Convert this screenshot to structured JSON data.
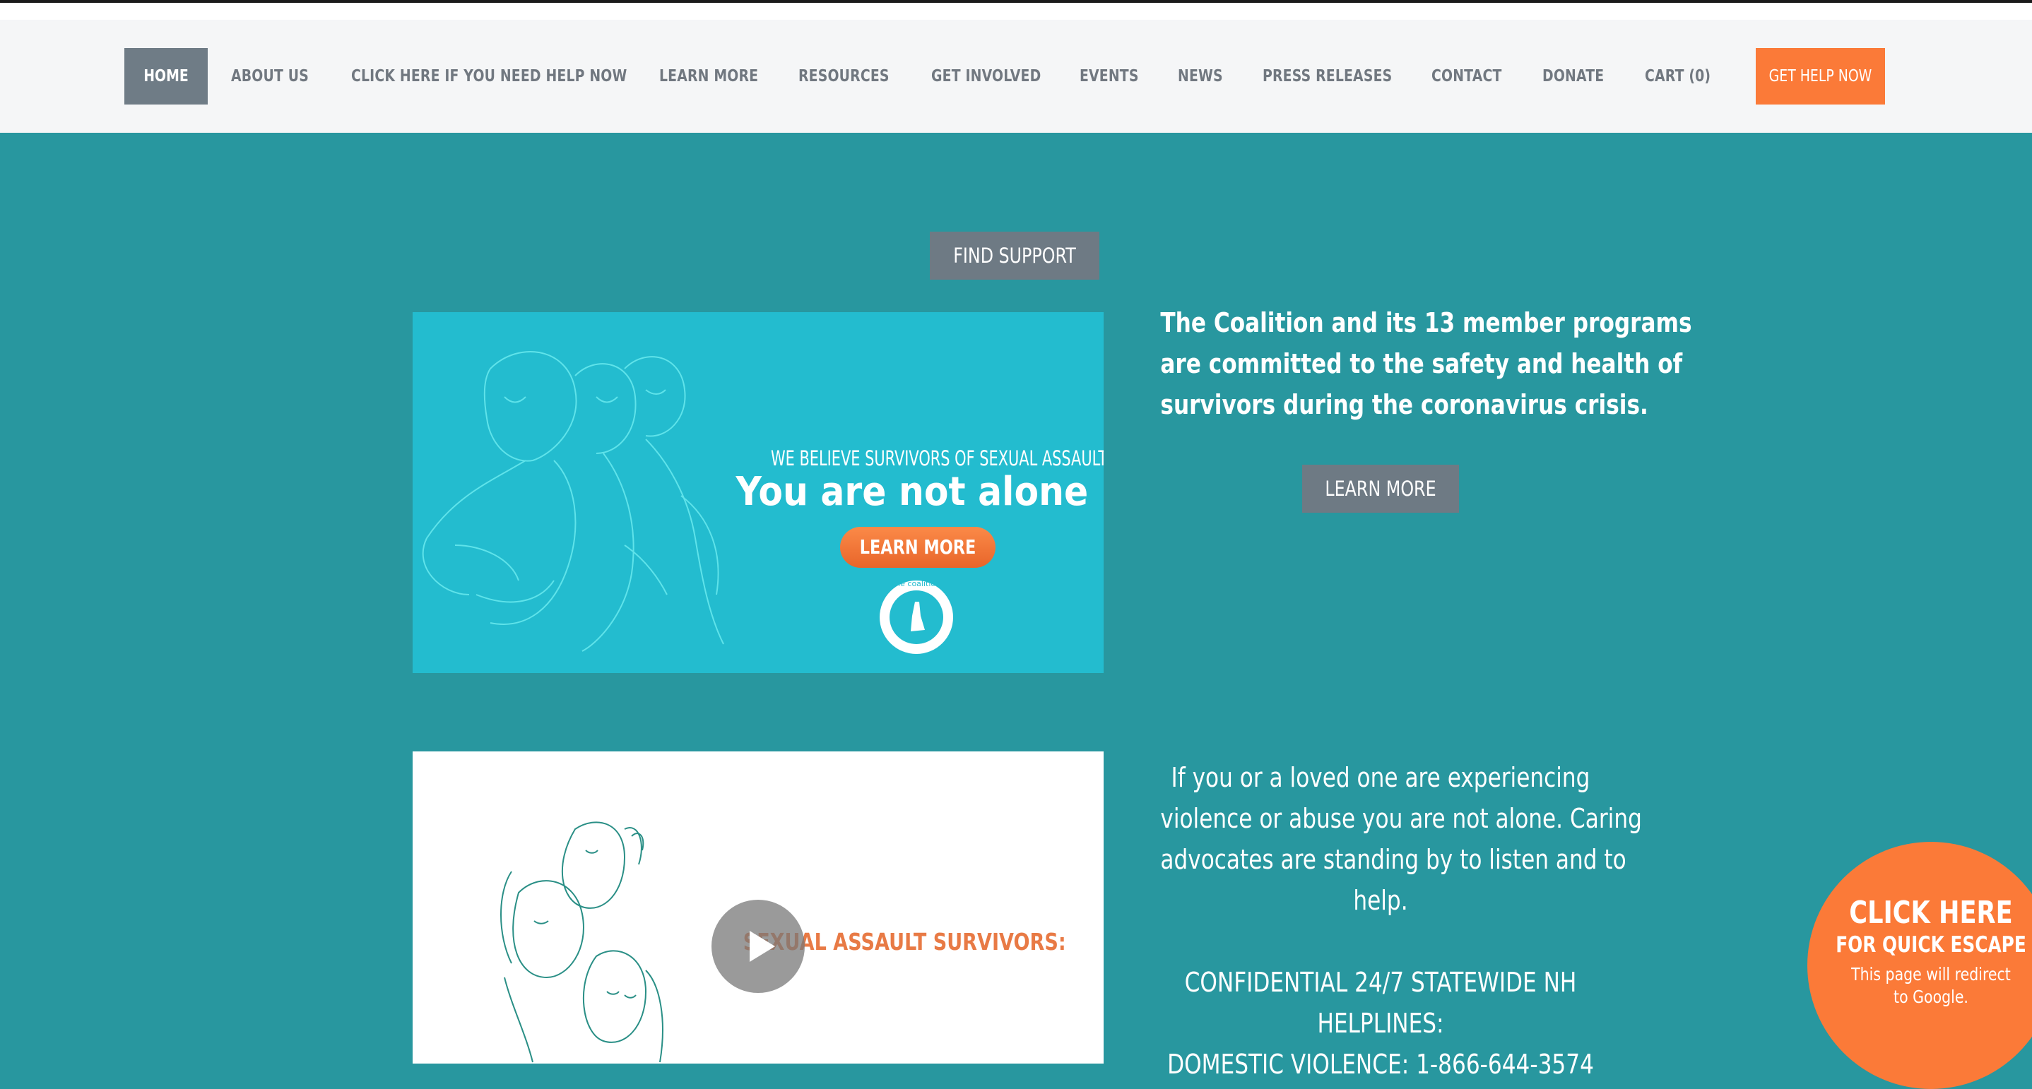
{
  "nav": {
    "items": [
      {
        "label": "HOME"
      },
      {
        "label": "ABOUT US"
      },
      {
        "label": "CLICK HERE IF YOU NEED HELP NOW"
      },
      {
        "label": "LEARN MORE"
      },
      {
        "label": "RESOURCES"
      },
      {
        "label": "GET INVOLVED"
      },
      {
        "label": "EVENTS"
      },
      {
        "label": "NEWS"
      },
      {
        "label": "PRESS RELEASES"
      },
      {
        "label": "CONTACT"
      },
      {
        "label": "DONATE"
      },
      {
        "label": "CART (0)"
      }
    ],
    "cta_label": "GET HELP NOW",
    "active_color": "#6f7c86",
    "cta_color": "#fb7a38"
  },
  "hero": {
    "find_support_label": "FIND SUPPORT",
    "coalition_text": [
      "The Coalition and its 13 member programs",
      "are committed to the safety and health of",
      "survivors during the coronavirus crisis."
    ],
    "learn_more_label": "LEARN MORE"
  },
  "banner1": {
    "headline_small": "WE BELIEVE SURVIVORS OF SEXUAL ASSAULT",
    "headline_big": "You are not alone",
    "button_label": "LEARN MORE",
    "logo_text": "the coalition",
    "bg_color": "#23bccf"
  },
  "banner2": {
    "video_title": "SEXUAL ASSAULT SURVIVORS:"
  },
  "help_text": {
    "paragraph": [
      "If you or a loved one are experiencing",
      "violence or abuse you are not alone. Caring",
      "advocates are standing by to listen and to",
      "help."
    ],
    "helplines_heading": [
      "CONFIDENTIAL 24/7 STATEWIDE NH",
      "HELPLINES:"
    ],
    "domestic_line": "DOMESTIC VIOLENCE: 1-866-644-3574"
  },
  "escape": {
    "line1": "CLICK HERE",
    "line2": "FOR QUICK ESCAPE",
    "line3": "This page will redirect",
    "line4": "to Google."
  },
  "colors": {
    "page_bg": "#28979f",
    "nav_bg": "#f5f6f7",
    "gray_button": "#6e7a84",
    "orange": "#fb7a38"
  }
}
